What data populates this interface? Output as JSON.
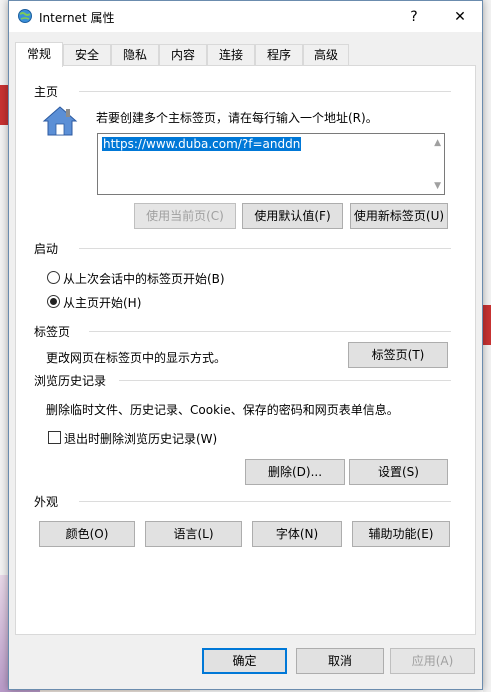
{
  "window": {
    "title": "Internet 属性",
    "help": "?",
    "close": "✕"
  },
  "tabs": [
    "常规",
    "安全",
    "隐私",
    "内容",
    "连接",
    "程序",
    "高级"
  ],
  "home": {
    "section": "主页",
    "instruction": "若要创建多个主标签页，请在每行输入一个地址(R)。",
    "url": "https://www.duba.com/?f=anddn",
    "use_current": "使用当前页(C)",
    "use_default": "使用默认值(F)",
    "use_new_tab": "使用新标签页(U)"
  },
  "startup": {
    "section": "启动",
    "option_last_session": "从上次会话中的标签页开始(B)",
    "option_home": "从主页开始(H)",
    "selected": "home"
  },
  "tabs_section": {
    "section": "标签页",
    "description": "更改网页在标签页中的显示方式。",
    "button": "标签页(T)"
  },
  "history": {
    "section": "浏览历史记录",
    "description": "删除临时文件、历史记录、Cookie、保存的密码和网页表单信息。",
    "delete_on_exit": "退出时删除浏览历史记录(W)",
    "delete_button": "删除(D)...",
    "settings_button": "设置(S)"
  },
  "appearance": {
    "section": "外观",
    "colors": "颜色(O)",
    "languages": "语言(L)",
    "fonts": "字体(N)",
    "accessibility": "辅助功能(E)"
  },
  "footer": {
    "ok": "确定",
    "cancel": "取消",
    "apply": "应用(A)"
  },
  "colors": {
    "accent": "#0078d7",
    "button_bg": "#e1e1e1",
    "dialog_bg": "#f0f0f0"
  }
}
